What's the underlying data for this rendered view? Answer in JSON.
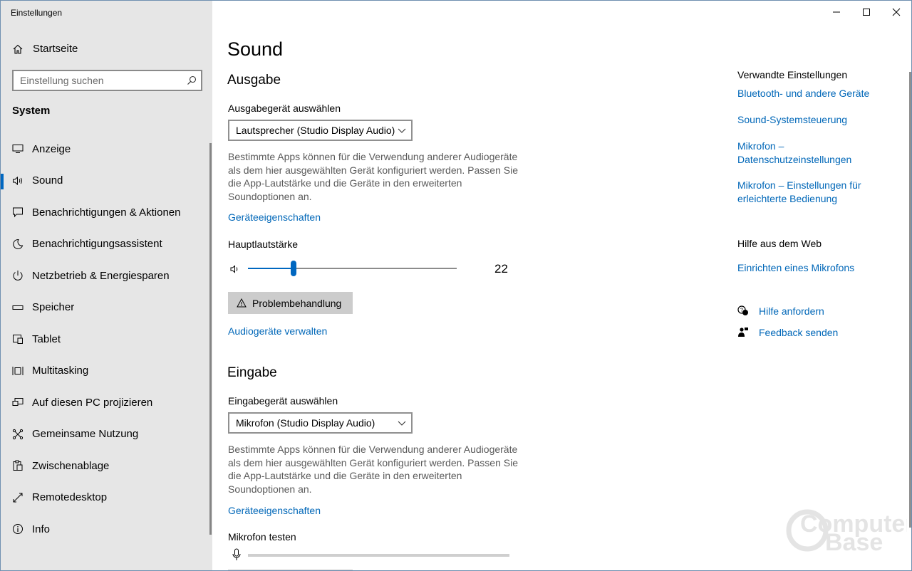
{
  "window": {
    "app_title": "Einstellungen",
    "controls": [
      "minimize-icon",
      "maximize-icon",
      "close-icon"
    ]
  },
  "sidebar": {
    "home_label": "Startseite",
    "search_placeholder": "Einstellung suchen",
    "section_title": "System",
    "items": [
      {
        "label": "Anzeige",
        "icon": "display-icon",
        "active": false
      },
      {
        "label": "Sound",
        "icon": "speaker-icon",
        "active": true
      },
      {
        "label": "Benachrichtigungen & Aktionen",
        "icon": "notification-icon",
        "active": false
      },
      {
        "label": "Benachrichtigungsassistent",
        "icon": "moon-icon",
        "active": false
      },
      {
        "label": "Netzbetrieb & Energiesparen",
        "icon": "power-icon",
        "active": false
      },
      {
        "label": "Speicher",
        "icon": "storage-icon",
        "active": false
      },
      {
        "label": "Tablet",
        "icon": "tablet-icon",
        "active": false
      },
      {
        "label": "Multitasking",
        "icon": "multitasking-icon",
        "active": false
      },
      {
        "label": "Auf diesen PC projizieren",
        "icon": "project-icon",
        "active": false
      },
      {
        "label": "Gemeinsame Nutzung",
        "icon": "share-icon",
        "active": false
      },
      {
        "label": "Zwischenablage",
        "icon": "clipboard-icon",
        "active": false
      },
      {
        "label": "Remotedesktop",
        "icon": "remote-desktop-icon",
        "active": false
      },
      {
        "label": "Info",
        "icon": "info-icon",
        "active": false
      }
    ]
  },
  "main": {
    "title": "Sound",
    "output": {
      "heading": "Ausgabe",
      "device_label": "Ausgabegerät auswählen",
      "device_value": "Lautsprecher (Studio Display Audio)",
      "description": "Bestimmte Apps können für die Verwendung anderer Audiogeräte als dem hier ausgewählten Gerät konfiguriert werden. Passen Sie die App-Lautstärke und die Geräte in den erweiterten Soundoptionen an.",
      "properties_link": "Geräteeigenschaften",
      "volume_label": "Hauptlautstärke",
      "volume_value": "22",
      "volume_fraction": 0.22,
      "troubleshoot_button": "Problembehandlung",
      "manage_link": "Audiogeräte verwalten"
    },
    "input": {
      "heading": "Eingabe",
      "device_label": "Eingabegerät auswählen",
      "device_value": "Mikrofon (Studio Display Audio)",
      "description": "Bestimmte Apps können für die Verwendung anderer Audiogeräte als dem hier ausgewählten Gerät konfiguriert werden. Passen Sie die App-Lautstärke und die Geräte in den erweiterten Soundoptionen an.",
      "properties_link": "Geräteeigenschaften",
      "test_label": "Mikrofon testen"
    }
  },
  "related": {
    "heading": "Verwandte Einstellungen",
    "links": [
      "Bluetooth- und andere Geräte",
      "Sound-Systemsteuerung",
      "Mikrofon – Datenschutzeinstellungen",
      "Mikrofon – Einstellungen für erleichterte Bedienung"
    ],
    "web_heading": "Hilfe aus dem Web",
    "web_links": [
      "Einrichten eines Mikrofons"
    ],
    "help_label": "Hilfe anfordern",
    "feedback_label": "Feedback senden"
  },
  "watermark": {
    "line1": "Computer",
    "line2": "Base"
  },
  "colors": {
    "accent": "#0067c0",
    "link": "#0067b8",
    "sidebar_bg": "#e6e6e6"
  }
}
